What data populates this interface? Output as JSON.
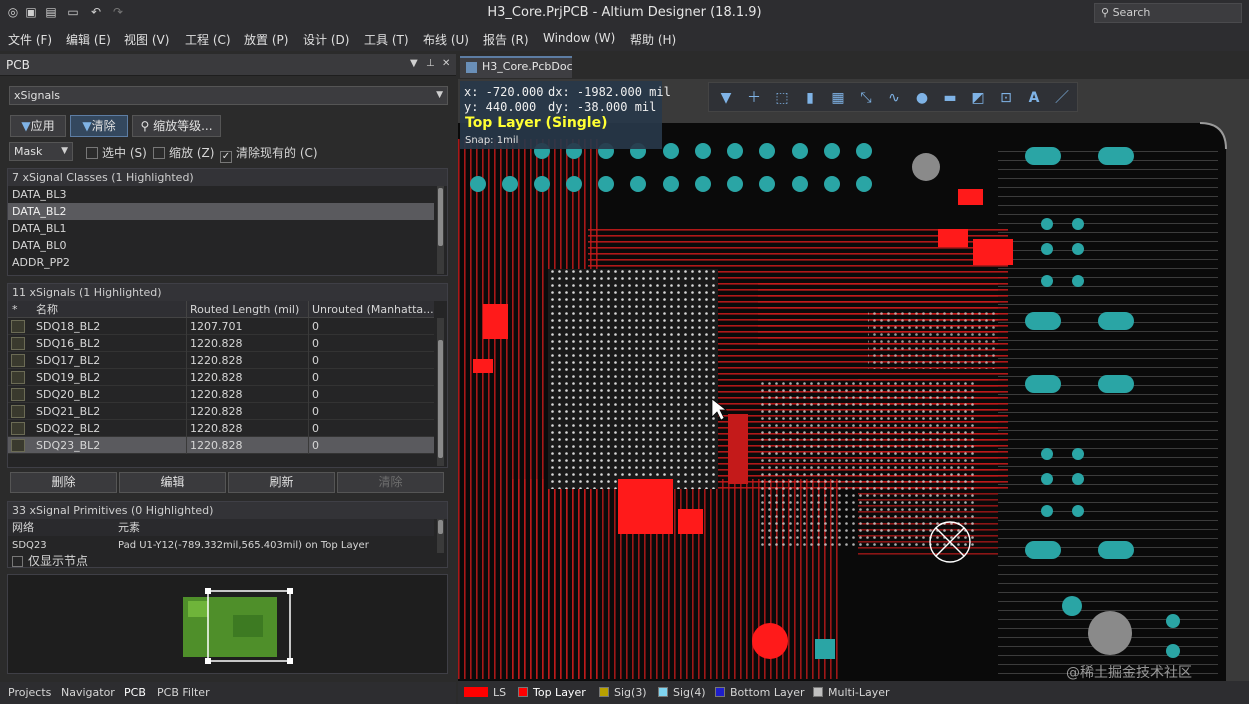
{
  "app": {
    "title": "H3_Core.PrjPCB - Altium Designer (18.1.9)",
    "search_placeholder": "Search"
  },
  "quick_icons": [
    "altium-logo-icon",
    "save-icon",
    "save-all-icon",
    "open-folder-icon",
    "undo-icon",
    "redo-icon"
  ],
  "menu": [
    "文件 (F)",
    "编辑 (E)",
    "视图 (V)",
    "工程 (C)",
    "放置 (P)",
    "设计 (D)",
    "工具 (T)",
    "布线 (U)",
    "报告 (R)",
    "Window (W)",
    "帮助 (H)"
  ],
  "panel": {
    "title": "PCB",
    "mode_select": "xSignals",
    "buttons": {
      "apply": "应用",
      "clear": "清除",
      "zoom_level": "缩放等级..."
    },
    "mask_select": "Mask",
    "checks": [
      {
        "label": "选中 (S)",
        "checked": false
      },
      {
        "label": "缩放 (Z)",
        "checked": false
      },
      {
        "label": "清除现有的 (C)",
        "checked": true
      }
    ],
    "classes": {
      "header": "7 xSignal Classes (1 Highlighted)",
      "items": [
        "DATA_BL3",
        "DATA_BL2",
        "DATA_BL1",
        "DATA_BL0",
        "ADDR_PP2"
      ],
      "selected_index": 1
    },
    "signals": {
      "header": "11 xSignals (1 Highlighted)",
      "columns": [
        "*",
        "名称",
        "Routed Length (mil)",
        "Unrouted (Manhatta..."
      ],
      "rows": [
        {
          "name": "SDQ18_BL2",
          "routed": "1207.701",
          "unrouted": "0"
        },
        {
          "name": "SDQ16_BL2",
          "routed": "1220.828",
          "unrouted": "0"
        },
        {
          "name": "SDQ17_BL2",
          "routed": "1220.828",
          "unrouted": "0"
        },
        {
          "name": "SDQ19_BL2",
          "routed": "1220.828",
          "unrouted": "0"
        },
        {
          "name": "SDQ20_BL2",
          "routed": "1220.828",
          "unrouted": "0"
        },
        {
          "name": "SDQ21_BL2",
          "routed": "1220.828",
          "unrouted": "0"
        },
        {
          "name": "SDQ22_BL2",
          "routed": "1220.828",
          "unrouted": "0"
        },
        {
          "name": "SDQ23_BL2",
          "routed": "1220.828",
          "unrouted": "0"
        }
      ],
      "selected_index": 7
    },
    "actions": [
      {
        "label": "删除",
        "enabled": true
      },
      {
        "label": "编辑",
        "enabled": true
      },
      {
        "label": "刷新",
        "enabled": true
      },
      {
        "label": "清除",
        "enabled": false
      }
    ],
    "primitives": {
      "header": "33 xSignal Primitives (0 Highlighted)",
      "columns": [
        "网络",
        "元素"
      ],
      "rows": [
        {
          "net": "SDQ23",
          "element": "Pad U1-Y12(-789.332mil,565.403mil) on Top Layer"
        }
      ],
      "only_nodes_label": "仅显示节点"
    }
  },
  "bottom_tabs": [
    "Projects",
    "Navigator",
    "PCB",
    "PCB Filter"
  ],
  "active_bottom_tab": "PCB",
  "document": {
    "tab": "H3_Core.PcbDoc",
    "hud": {
      "x": "x:  -720.000",
      "dx": "dx: -1982.000 mil",
      "y": "y:  440.000",
      "dy": "dy:  -38.000  mil",
      "layer": "Top Layer (Single)",
      "snap": "Snap: 1mil"
    },
    "toolbar_icons": [
      "filter-icon",
      "cross-icon",
      "select-rect-icon",
      "chart-icon",
      "component-icon",
      "route-icon",
      "interactive-route-icon",
      "pad-icon",
      "fill-icon",
      "region-icon",
      "dimension-icon",
      "text-icon",
      "line-icon"
    ]
  },
  "layers": [
    {
      "label": "LS",
      "color": "#ff0000"
    },
    {
      "label": "Top Layer",
      "color": "#ff0000"
    },
    {
      "label": "Sig(3)",
      "color": "#b8a000"
    },
    {
      "label": "Sig(4)",
      "color": "#7fd4f0"
    },
    {
      "label": "Bottom Layer",
      "color": "#1e1ecc"
    },
    {
      "label": "Multi-Layer",
      "color": "#c0c0c0"
    }
  ],
  "watermark": "@稀土掘金技术社区"
}
